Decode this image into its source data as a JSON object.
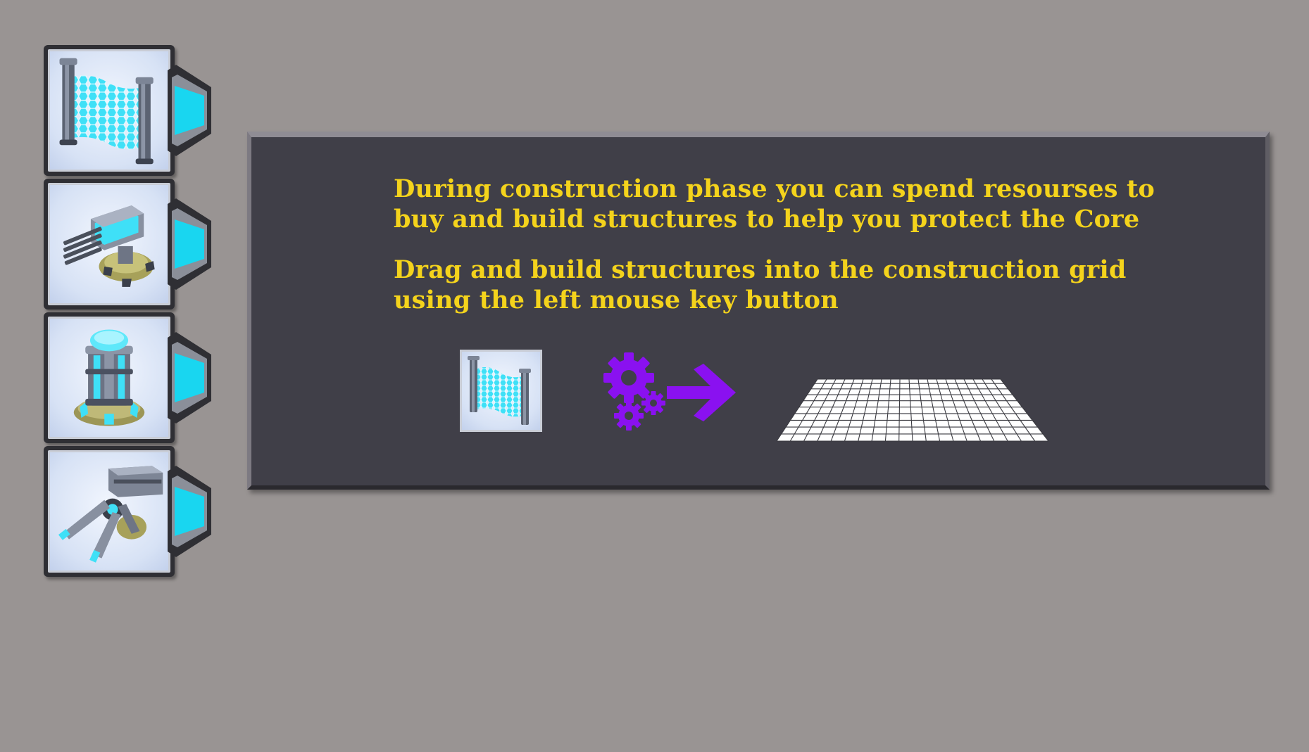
{
  "structures": [
    {
      "name": "Energy Wall",
      "icon": "energy-wall-icon"
    },
    {
      "name": "Gatling Turret",
      "icon": "gatling-turret-icon"
    },
    {
      "name": "Energy Pylon",
      "icon": "energy-pylon-icon"
    },
    {
      "name": "Heavy Cannon",
      "icon": "heavy-cannon-icon"
    }
  ],
  "info_panel": {
    "paragraph_1_line_1": "During construction phase you can spend resourses to",
    "paragraph_1_line_2": "buy and build structures to help you protect the Core",
    "paragraph_2_line_1": "Drag and build structures into the construction grid",
    "paragraph_2_line_2": "using the left mouse key button"
  },
  "illustration": {
    "steps": [
      "energy-wall-icon",
      "gears-icon",
      "arrow-right-icon",
      "construction-grid-icon"
    ]
  },
  "colors": {
    "background": "#999493",
    "panel": "#403f48",
    "text_yellow": "#f4d31c",
    "accent_cyan": "#19d6f0",
    "accent_purple": "#8a11f0"
  }
}
